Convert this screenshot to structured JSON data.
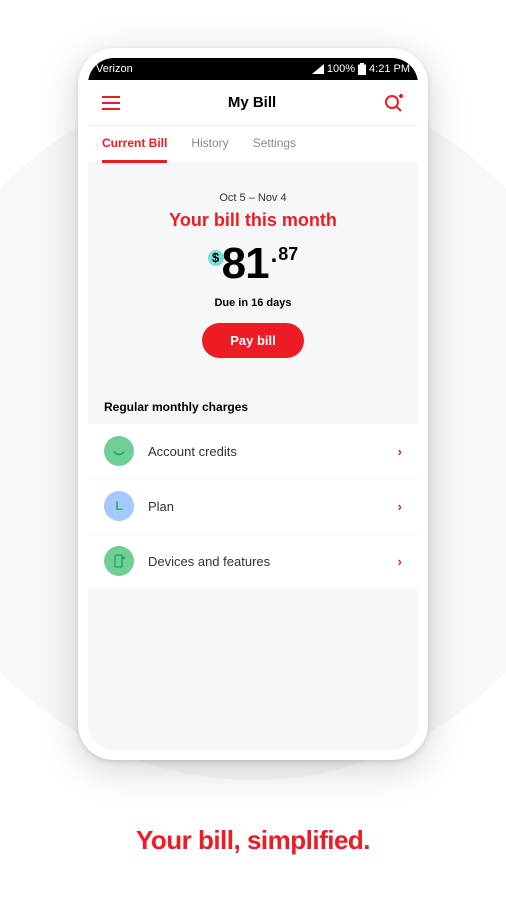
{
  "status": {
    "carrier": "Verizon",
    "battery_pct": "100%",
    "time": "4:21 PM"
  },
  "header": {
    "title": "My Bill"
  },
  "tabs": [
    {
      "label": "Current Bill",
      "active": true
    },
    {
      "label": "History",
      "active": false
    },
    {
      "label": "Settings",
      "active": false
    }
  ],
  "bill": {
    "date_range": "Oct 5 – Nov 4",
    "title": "Your bill this month",
    "currency": "$",
    "whole": "81",
    "cents": "87",
    "due": "Due in 16 days",
    "pay_label": "Pay bill"
  },
  "charges": {
    "section_title": "Regular monthly charges",
    "items": [
      {
        "label": "Account credits",
        "icon_bg": "#6fcf97",
        "icon_content": "smile"
      },
      {
        "label": "Plan",
        "icon_bg": "#a5c8ff",
        "icon_content": "L"
      },
      {
        "label": "Devices and features",
        "icon_bg": "#6fcf97",
        "icon_content": "device"
      }
    ]
  },
  "tagline": "Your bill, simplified."
}
